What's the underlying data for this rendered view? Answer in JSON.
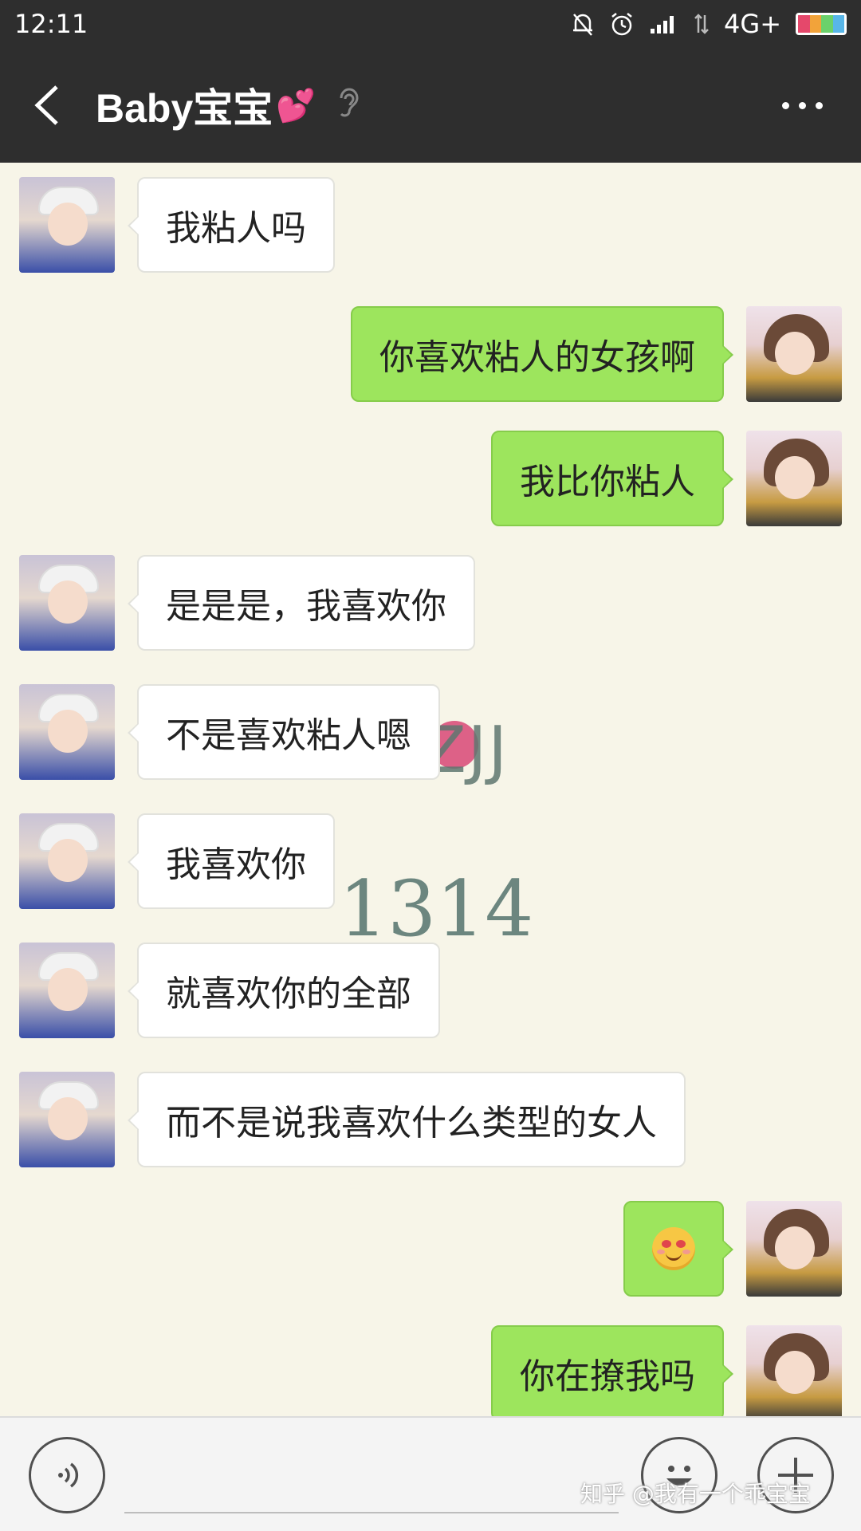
{
  "status_bar": {
    "time": "12:11",
    "network": "4G+"
  },
  "header": {
    "title": "Baby宝宝",
    "title_emoji": "💕"
  },
  "chat": {
    "watermark_text_1": "ZJJ",
    "watermark_text_2": "1314",
    "messages": [
      {
        "side": "left",
        "text": "我粘人吗"
      },
      {
        "side": "right",
        "text": "你喜欢粘人的女孩啊"
      },
      {
        "side": "right",
        "text": "我比你粘人"
      },
      {
        "side": "left",
        "text": "是是是，我喜欢你"
      },
      {
        "side": "left",
        "text": "不是喜欢粘人嗯"
      },
      {
        "side": "left",
        "text": "我喜欢你"
      },
      {
        "side": "left",
        "text": "就喜欢你的全部"
      },
      {
        "side": "left",
        "text": "而不是说我喜欢什么类型的女人"
      },
      {
        "side": "right",
        "text": "",
        "emoji": "smiling-face-with-heart-eyes"
      },
      {
        "side": "right",
        "text": "你在撩我吗"
      }
    ]
  },
  "footer": {
    "watermark": "知乎 @我有一个乖宝宝"
  },
  "colors": {
    "bar": "#2e2e2e",
    "chat_bg": "#f7f5e8",
    "bubble_right": "#9de55d",
    "bubble_left": "#ffffff"
  }
}
